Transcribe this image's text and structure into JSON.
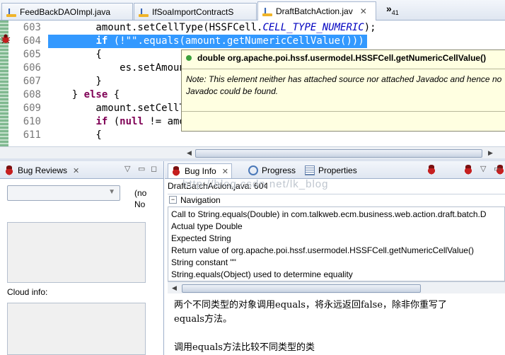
{
  "editor_tabs": [
    {
      "label": "FeedBackDAOImpl.java"
    },
    {
      "label": "IfSoaImportContractS"
    },
    {
      "label": "DraftBatchAction.jav",
      "close": "✕"
    }
  ],
  "tab_overflow": {
    "label": "»",
    "count": "41"
  },
  "code_lines": [
    {
      "num": "603",
      "parts": [
        {
          "t": "        amount.setCellType(HSSFCell."
        },
        {
          "t": "CELL_TYPE_NUMERIC",
          "c": "const"
        },
        {
          "t": ");"
        }
      ]
    },
    {
      "num": "604",
      "highlight": true,
      "parts": [
        {
          "t": "        "
        },
        {
          "t": "if",
          "c": "kw"
        },
        {
          "t": " (!"
        },
        {
          "t": "\"\"",
          "c": "str"
        },
        {
          "t": ".equals(amount.getNumericCellValue()))"
        }
      ]
    },
    {
      "num": "605",
      "parts": [
        {
          "t": "        {"
        }
      ]
    },
    {
      "num": "606",
      "parts": [
        {
          "t": "            es.setAmoun"
        }
      ]
    },
    {
      "num": "607",
      "parts": [
        {
          "t": "        }"
        }
      ]
    },
    {
      "num": "608",
      "parts": [
        {
          "t": "    } "
        },
        {
          "t": "else",
          "c": "kw"
        },
        {
          "t": " {"
        }
      ]
    },
    {
      "num": "609",
      "parts": [
        {
          "t": "        amount.setCellT"
        }
      ]
    },
    {
      "num": "610",
      "parts": [
        {
          "t": "        "
        },
        {
          "t": "if",
          "c": "kw"
        },
        {
          "t": " ("
        },
        {
          "t": "null",
          "c": "kw"
        },
        {
          "t": " != amo"
        }
      ]
    },
    {
      "num": "611",
      "parts": [
        {
          "t": "        {"
        }
      ]
    }
  ],
  "hover": {
    "signature": "double org.apache.poi.hssf.usermodel.HSSFCell.getNumericCellValue()",
    "note": "Note: This element neither has attached source nor attached Javadoc and hence no Javadoc could be found."
  },
  "bug_reviews": {
    "title": "Bug Reviews",
    "side_label_1": "(no",
    "side_label_2": "No",
    "cloud_label": "Cloud info:"
  },
  "bug_info": {
    "tabs": [
      {
        "label": "Bug Info"
      },
      {
        "label": "Progress"
      },
      {
        "label": "Properties"
      }
    ],
    "file_line": "DraftBatchAction.java: 604",
    "navigation_label": "Navigation",
    "navigation_items": [
      "Call to String.equals(Double) in com.talkweb.ecm.business.web.action.draft.batch.D",
      "Actual type Double",
      "Expected String",
      "Return value of org.apache.poi.hssf.usermodel.HSSFCell.getNumericCellValue()",
      "String constant \"\"",
      "String.equals(Object) used to determine equality"
    ]
  },
  "description": {
    "line1": "两个不同类型的对象调用equals，将永远返回false，除非你重写了",
    "line2": "equals方法。",
    "line3": "调用equals方法比较不同类型的类"
  },
  "watermark": "http://blog.csdn.net/lk_blog",
  "colors": {
    "highlight": "#3399ff",
    "hover_bg": "#ffffe1",
    "keyword": "#7f0055",
    "constant": "#0000c0"
  }
}
